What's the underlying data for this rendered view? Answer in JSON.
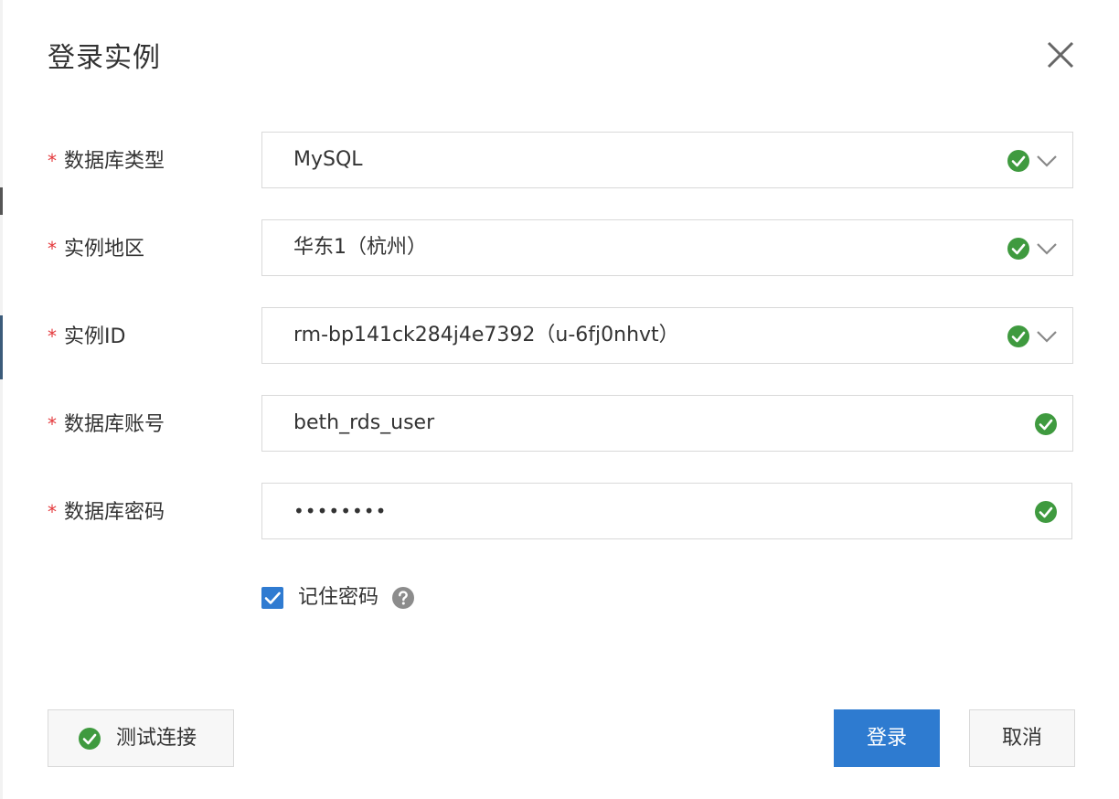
{
  "dialog": {
    "title": "登录实例"
  },
  "form": {
    "db_type": {
      "label": "数据库类型",
      "value": "MySQL"
    },
    "region": {
      "label": "实例地区",
      "value": "华东1（杭州）"
    },
    "instance_id": {
      "label": "实例ID",
      "value": "rm-bp141ck284j4e7392（u-6fj0nhvt）"
    },
    "db_account": {
      "label": "数据库账号",
      "value": "beth_rds_user"
    },
    "db_password": {
      "label": "数据库密码",
      "value": "••••••••"
    },
    "required_mark": "*"
  },
  "remember_password": {
    "label": "记住密码",
    "checked": true
  },
  "buttons": {
    "test_connection": "测试连接",
    "login": "登录",
    "cancel": "取消"
  },
  "colors": {
    "primary": "#2e7bd0",
    "success": "#3f9a3f",
    "required": "#e4393c"
  },
  "icons": [
    "close-icon",
    "check-circle-icon",
    "chevron-down-icon",
    "question-circle-icon",
    "checkbox-checked-icon"
  ]
}
